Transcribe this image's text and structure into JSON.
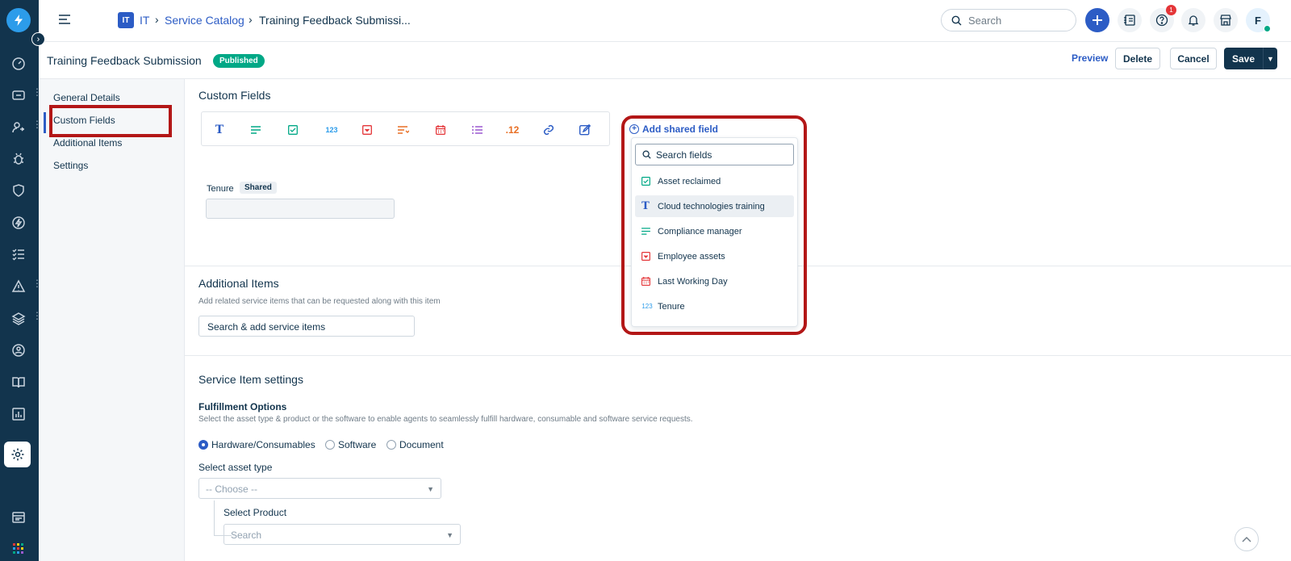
{
  "colors": {
    "rail": "#12344d",
    "brand": "#2c5cc5",
    "published": "#00a886",
    "annotation": "#b31717"
  },
  "topbar": {
    "badge": "IT",
    "crumbs": [
      "IT",
      "Service Catalog",
      "Training Feedback Submissi..."
    ],
    "search_placeholder": "Search",
    "notification_count": "1",
    "avatar_initial": "F"
  },
  "header": {
    "title": "Training Feedback Submission",
    "status": "Published",
    "preview": "Preview",
    "delete": "Delete",
    "cancel": "Cancel",
    "save": "Save"
  },
  "subnav": {
    "items": [
      "General Details",
      "Custom Fields",
      "Additional Items",
      "Settings"
    ],
    "active": "Custom Fields"
  },
  "custom_fields": {
    "title": "Custom Fields",
    "toolbar": [
      {
        "icon": "text-field-icon",
        "glyph": "T"
      },
      {
        "icon": "paragraph-field-icon",
        "glyph": "≡"
      },
      {
        "icon": "checkbox-field-icon",
        "glyph": "✓"
      },
      {
        "icon": "number-field-icon",
        "glyph": "123"
      },
      {
        "icon": "dropdown-field-icon",
        "glyph": "▾"
      },
      {
        "icon": "dependent-field-icon",
        "glyph": "≡"
      },
      {
        "icon": "date-field-icon",
        "glyph": "▦"
      },
      {
        "icon": "multi-select-field-icon",
        "glyph": "☰"
      },
      {
        "icon": "decimal-field-icon",
        "glyph": ".12"
      },
      {
        "icon": "url-field-icon",
        "glyph": "🔗"
      },
      {
        "icon": "rich-text-field-icon",
        "glyph": "✎"
      }
    ],
    "tenure_label": "Tenure",
    "shared_chip": "Shared"
  },
  "shared_field": {
    "add_label": "Add shared field",
    "search_placeholder": "Search fields",
    "items": [
      {
        "label": "Asset reclaimed",
        "icon": "checkbox-icon"
      },
      {
        "label": "Cloud technologies training",
        "icon": "text-icon"
      },
      {
        "label": "Compliance manager",
        "icon": "paragraph-icon"
      },
      {
        "label": "Employee assets",
        "icon": "dropdown-icon"
      },
      {
        "label": "Last Working Day",
        "icon": "calendar-icon"
      },
      {
        "label": "Tenure",
        "icon": "number-icon"
      }
    ],
    "highlighted_index": 1
  },
  "additional_items": {
    "title": "Additional Items",
    "help": "Add related service items that can be requested along with this item",
    "search_placeholder": "Search & add service items"
  },
  "settings": {
    "title": "Service Item settings",
    "fulfillment_title": "Fulfillment Options",
    "fulfillment_help": "Select the asset type & product or the software to enable agents to seamlessly fulfill hardware, consumable and software service requests.",
    "options": [
      "Hardware/Consumables",
      "Software",
      "Document"
    ],
    "selected_option": "Hardware/Consumables",
    "asset_type_label": "Select asset type",
    "asset_type_value": "-- Choose --",
    "product_label": "Select Product",
    "product_placeholder": "Search"
  }
}
